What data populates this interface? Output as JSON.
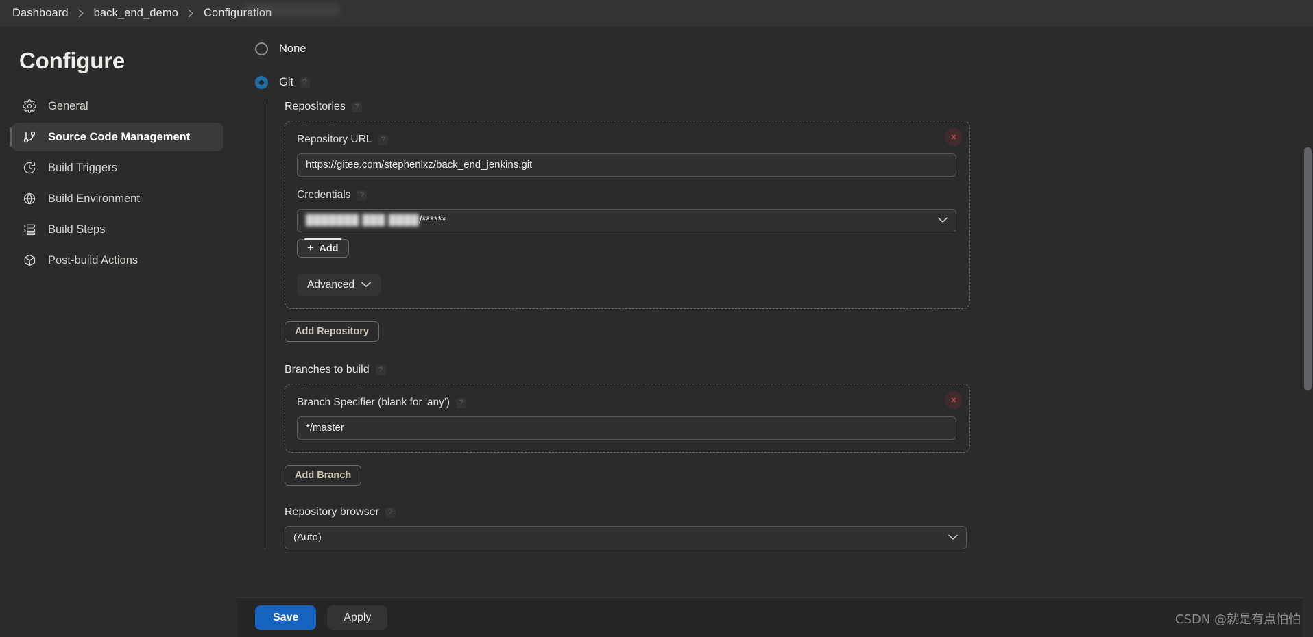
{
  "breadcrumb": {
    "items": [
      {
        "label": "Dashboard"
      },
      {
        "label": "back_end_demo"
      },
      {
        "label": "Configuration"
      }
    ],
    "separator": "›"
  },
  "sidebar": {
    "title": "Configure",
    "items": [
      {
        "label": "General",
        "icon": "gear-icon",
        "active": false
      },
      {
        "label": "Source Code Management",
        "icon": "git-branch-icon",
        "active": true
      },
      {
        "label": "Build Triggers",
        "icon": "clock-icon",
        "active": false
      },
      {
        "label": "Build Environment",
        "icon": "globe-icon",
        "active": false
      },
      {
        "label": "Build Steps",
        "icon": "list-icon",
        "active": false
      },
      {
        "label": "Post-build Actions",
        "icon": "package-icon",
        "active": false
      }
    ]
  },
  "scm": {
    "options": [
      {
        "label": "None",
        "selected": false
      },
      {
        "label": "Git",
        "selected": true
      }
    ],
    "repositories_label": "Repositories",
    "repository": {
      "url_label": "Repository URL",
      "url_value": "https://gitee.com/stephenlxz/back_end_jenkins.git",
      "credentials_label": "Credentials",
      "credentials_value_masked": "███████ ███ ████",
      "credentials_value_suffix": "/******",
      "add_credentials_label": "Add",
      "advanced_label": "Advanced"
    },
    "add_repository_label": "Add Repository",
    "branches_label": "Branches to build",
    "branch": {
      "specifier_label": "Branch Specifier (blank for 'any')",
      "specifier_value": "*/master"
    },
    "add_branch_label": "Add Branch",
    "repository_browser_label": "Repository browser",
    "repository_browser_value": "(Auto)",
    "help_badge": "?",
    "delete_badge": "×",
    "plus_glyph": "+"
  },
  "footer": {
    "save_label": "Save",
    "apply_label": "Apply"
  },
  "watermark": "CSDN @就是有点怕怕",
  "colors": {
    "accent_blue": "#1464c0",
    "radio_blue": "#1f6fa5",
    "delete_red": "#e05a5a",
    "outline_text": "#cfc6b8",
    "background": "#2b2b2b",
    "topbar": "#333333",
    "bottombar": "#252525"
  }
}
